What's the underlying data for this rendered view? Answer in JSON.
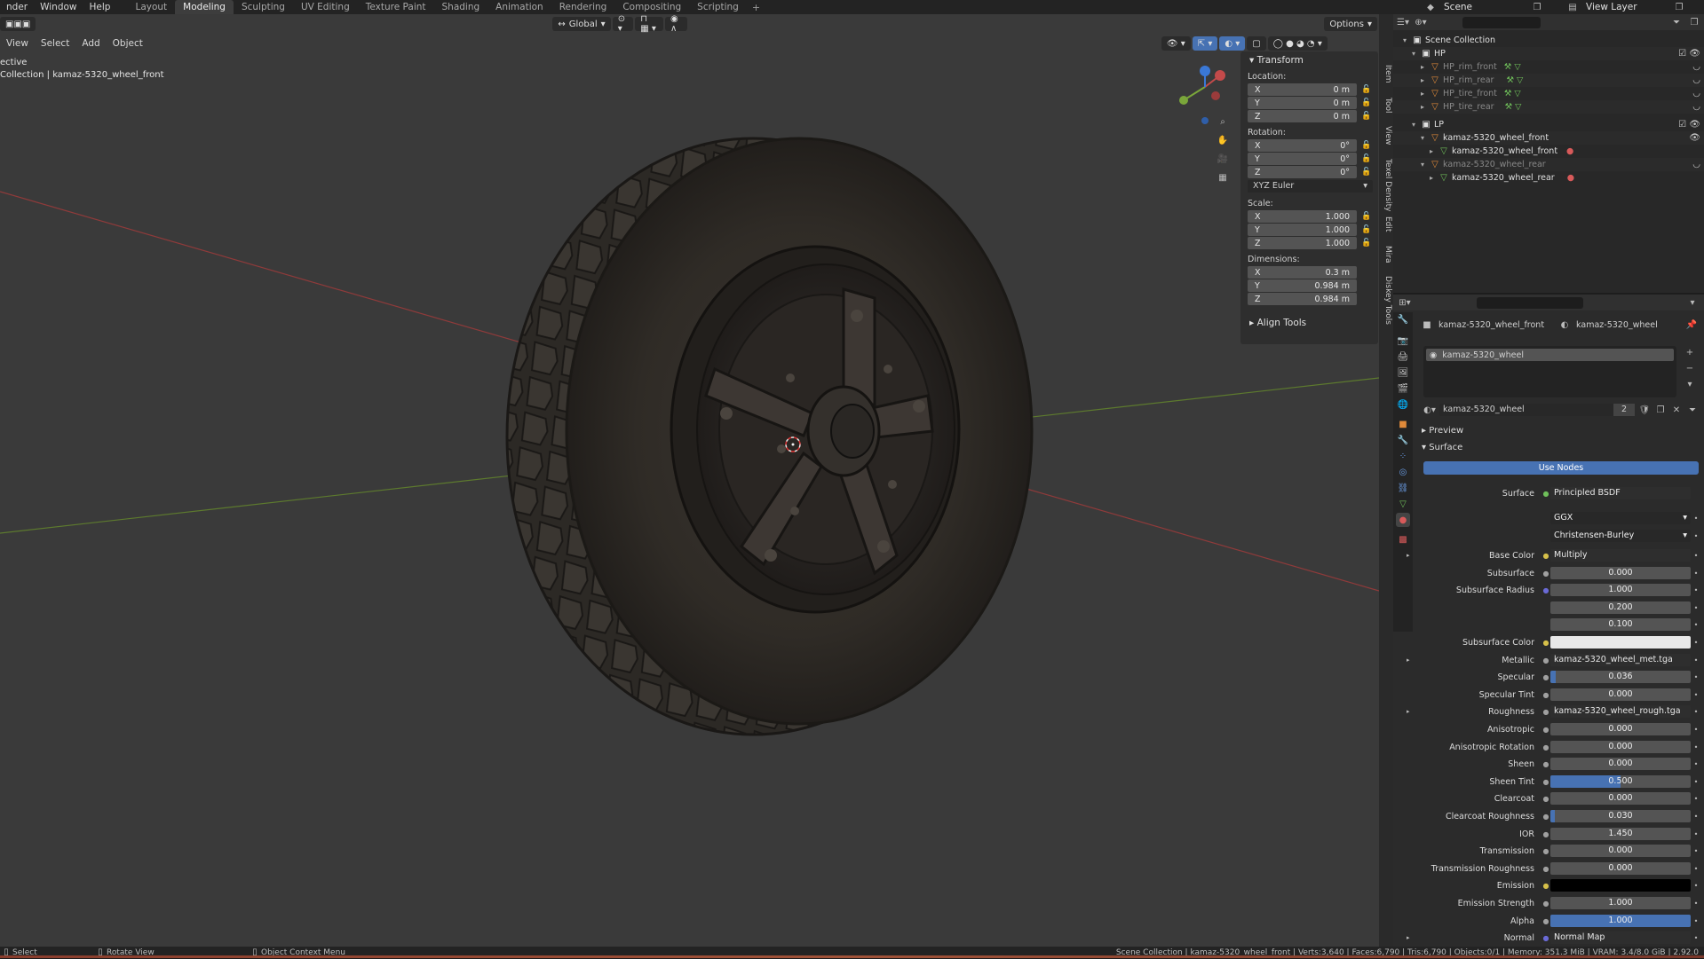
{
  "topbar": {
    "menus": [
      "nder",
      "Window",
      "Help"
    ],
    "workspace_tabs": [
      "Layout",
      "Modeling",
      "Sculpting",
      "UV Editing",
      "Texture Paint",
      "Shading",
      "Animation",
      "Rendering",
      "Compositing",
      "Scripting"
    ],
    "active_tab": "Modeling",
    "scene": "Scene",
    "view_layer": "View Layer"
  },
  "viewport": {
    "menus": [
      "View",
      "Select",
      "Add",
      "Object"
    ],
    "transform_orientation": "Global",
    "options": "Options",
    "info_line1": "ective",
    "info_line2": "Collection | kamaz-5320_wheel_front"
  },
  "npanel": {
    "section": "Transform",
    "location_label": "Location:",
    "location": [
      {
        "axis": "X",
        "value": "0 m"
      },
      {
        "axis": "Y",
        "value": "0 m"
      },
      {
        "axis": "Z",
        "value": "0 m"
      }
    ],
    "rotation_label": "Rotation:",
    "rotation": [
      {
        "axis": "X",
        "value": "0°"
      },
      {
        "axis": "Y",
        "value": "0°"
      },
      {
        "axis": "Z",
        "value": "0°"
      }
    ],
    "rotation_mode": "XYZ Euler",
    "scale_label": "Scale:",
    "scale": [
      {
        "axis": "X",
        "value": "1.000"
      },
      {
        "axis": "Y",
        "value": "1.000"
      },
      {
        "axis": "Z",
        "value": "1.000"
      }
    ],
    "dimensions_label": "Dimensions:",
    "dimensions": [
      {
        "axis": "X",
        "value": "0.3 m"
      },
      {
        "axis": "Y",
        "value": "0.984 m"
      },
      {
        "axis": "Z",
        "value": "0.984 m"
      }
    ],
    "align_tools": "Align Tools",
    "side_tabs": [
      "Item",
      "Tool",
      "View",
      "Texel Density",
      "Edit",
      "Mira",
      "Diskey Tools"
    ]
  },
  "outliner": {
    "root": "Scene Collection",
    "rows": [
      {
        "label": "HP",
        "kind": "collection"
      },
      {
        "label": "HP_rim_front",
        "kind": "object-dim"
      },
      {
        "label": "HP_rim_rear",
        "kind": "object-dim"
      },
      {
        "label": "HP_tire_front",
        "kind": "object-dim"
      },
      {
        "label": "HP_tire_rear",
        "kind": "object-dim"
      },
      {
        "label": "LP",
        "kind": "collection"
      },
      {
        "label": "kamaz-5320_wheel_front",
        "kind": "object"
      },
      {
        "label": "kamaz-5320_wheel_front",
        "kind": "mesh"
      },
      {
        "label": "kamaz-5320_wheel_rear",
        "kind": "object-dim"
      },
      {
        "label": "kamaz-5320_wheel_rear",
        "kind": "mesh"
      }
    ]
  },
  "properties": {
    "breadcrumb_object": "kamaz-5320_wheel_front",
    "breadcrumb_material": "kamaz-5320_wheel",
    "slot": "kamaz-5320_wheel",
    "material_name": "kamaz-5320_wheel",
    "user_count": "2",
    "preview": "Preview",
    "surface_section": "Surface",
    "use_nodes": "Use Nodes",
    "surface_label": "Surface",
    "surface_shader": "Principled BSDF",
    "distribution": "GGX",
    "subsurface_method": "Christensen-Burley",
    "rows": [
      {
        "label": "Base Color",
        "value": "Multiply",
        "type": "link",
        "dot": "#d6c04a",
        "expand": true
      },
      {
        "label": "Subsurface",
        "value": "0.000",
        "type": "num",
        "dot": "#a0a0a0",
        "fill": 0
      },
      {
        "label": "Subsurface Radius",
        "value": "1.000",
        "type": "num",
        "dot": "#6a6ad6",
        "fill": 0
      },
      {
        "label": "",
        "value": "0.200",
        "type": "num",
        "dot": "",
        "fill": 0
      },
      {
        "label": "",
        "value": "0.100",
        "type": "num",
        "dot": "",
        "fill": 0
      },
      {
        "label": "Subsurface Color",
        "value": "",
        "type": "color",
        "dot": "#d6c04a",
        "color": "#e8e8e8"
      },
      {
        "label": "Metallic",
        "value": "kamaz-5320_wheel_met.tga",
        "type": "link",
        "dot": "#a0a0a0",
        "expand": true
      },
      {
        "label": "Specular",
        "value": "0.036",
        "type": "num",
        "dot": "#a0a0a0",
        "fill": 0.036
      },
      {
        "label": "Specular Tint",
        "value": "0.000",
        "type": "num",
        "dot": "#a0a0a0",
        "fill": 0
      },
      {
        "label": "Roughness",
        "value": "kamaz-5320_wheel_rough.tga",
        "type": "link",
        "dot": "#a0a0a0",
        "expand": true
      },
      {
        "label": "Anisotropic",
        "value": "0.000",
        "type": "num",
        "dot": "#a0a0a0",
        "fill": 0
      },
      {
        "label": "Anisotropic Rotation",
        "value": "0.000",
        "type": "num",
        "dot": "#a0a0a0",
        "fill": 0
      },
      {
        "label": "Sheen",
        "value": "0.000",
        "type": "num",
        "dot": "#a0a0a0",
        "fill": 0
      },
      {
        "label": "Sheen Tint",
        "value": "0.500",
        "type": "num",
        "dot": "#a0a0a0",
        "fill": 0.5
      },
      {
        "label": "Clearcoat",
        "value": "0.000",
        "type": "num",
        "dot": "#a0a0a0",
        "fill": 0
      },
      {
        "label": "Clearcoat Roughness",
        "value": "0.030",
        "type": "num",
        "dot": "#a0a0a0",
        "fill": 0.03
      },
      {
        "label": "IOR",
        "value": "1.450",
        "type": "num",
        "dot": "#a0a0a0",
        "fill": 0
      },
      {
        "label": "Transmission",
        "value": "0.000",
        "type": "num",
        "dot": "#a0a0a0",
        "fill": 0
      },
      {
        "label": "Transmission Roughness",
        "value": "0.000",
        "type": "num",
        "dot": "#a0a0a0",
        "fill": 0
      },
      {
        "label": "Emission",
        "value": "",
        "type": "color",
        "dot": "#d6c04a",
        "color": "#000000"
      },
      {
        "label": "Emission Strength",
        "value": "1.000",
        "type": "num",
        "dot": "#a0a0a0",
        "fill": 0
      },
      {
        "label": "Alpha",
        "value": "1.000",
        "type": "num",
        "dot": "#a0a0a0",
        "fill": 1
      },
      {
        "label": "Normal",
        "value": "Normal Map",
        "type": "link",
        "dot": "#6a6ad6",
        "expand": true
      }
    ]
  },
  "status": {
    "select": "Select",
    "rotate": "Rotate View",
    "context": "Object Context Menu",
    "stats": "Scene Collection | kamaz-5320_wheel_front | Verts:3,640 | Faces:6,790 | Tris:6,790 | Objects:0/1 | Memory: 351.3 MiB | VRAM: 3.4/8.0 GiB | 2.92.0"
  },
  "colors": {
    "accent": "#4772b3",
    "x_axis": "#c44a4a",
    "y_axis": "#7aa63a",
    "z_axis": "#3a78d6"
  }
}
